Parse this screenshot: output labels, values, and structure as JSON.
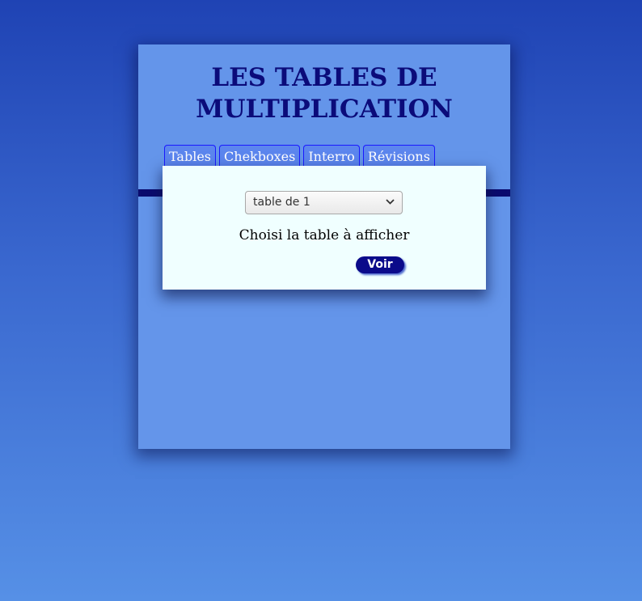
{
  "header": {
    "title_line1": "LES TABLES DE",
    "title_line2": "MULTIPLICATION"
  },
  "tabs": [
    {
      "label": "Tables"
    },
    {
      "label": "Chekboxes"
    },
    {
      "label": "Interro"
    },
    {
      "label": "Révisions"
    }
  ],
  "table_picker": {
    "selected": "table de 1",
    "prompt": "Choisi la table à afficher",
    "submit_label": "Voir"
  },
  "colors": {
    "panel": "#6495ea",
    "title": "#0b0b7a",
    "band": "#0b0b6e",
    "card": "#f0ffff",
    "button": "#0b0b8a"
  }
}
